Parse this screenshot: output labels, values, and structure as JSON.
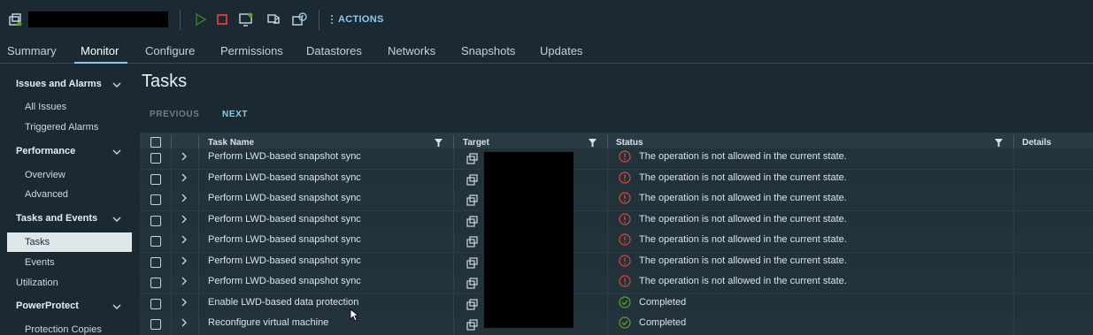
{
  "toolbar": {
    "actions_label": "ACTIONS",
    "icons": [
      "vm-icon",
      "power-on-icon",
      "power-off-icon",
      "console-icon",
      "migrate-icon",
      "snapshot-icon"
    ]
  },
  "tabs": [
    {
      "label": "Summary"
    },
    {
      "label": "Monitor",
      "active": true
    },
    {
      "label": "Configure"
    },
    {
      "label": "Permissions"
    },
    {
      "label": "Datastores"
    },
    {
      "label": "Networks"
    },
    {
      "label": "Snapshots"
    },
    {
      "label": "Updates"
    }
  ],
  "sidebar": {
    "issues_head": "Issues and Alarms",
    "all_issues": "All Issues",
    "triggered_alarms": "Triggered Alarms",
    "performance_head": "Performance",
    "overview": "Overview",
    "advanced": "Advanced",
    "tasks_head": "Tasks and Events",
    "tasks": "Tasks",
    "events": "Events",
    "utilization": "Utilization",
    "powerprotect_head": "PowerProtect",
    "protection_copies": "Protection Copies"
  },
  "main": {
    "title": "Tasks",
    "previous": "PREVIOUS",
    "next": "NEXT"
  },
  "table": {
    "columns": {
      "task_name": "Task Name",
      "target": "Target",
      "status": "Status",
      "details": "Details"
    },
    "rows": [
      {
        "task": "Perform LWD-based snapshot sync",
        "status": "The operation is not allowed in the current state.",
        "state": "error"
      },
      {
        "task": "Perform LWD-based snapshot sync",
        "status": "The operation is not allowed in the current state.",
        "state": "error"
      },
      {
        "task": "Perform LWD-based snapshot sync",
        "status": "The operation is not allowed in the current state.",
        "state": "error"
      },
      {
        "task": "Perform LWD-based snapshot sync",
        "status": "The operation is not allowed in the current state.",
        "state": "error"
      },
      {
        "task": "Perform LWD-based snapshot sync",
        "status": "The operation is not allowed in the current state.",
        "state": "error"
      },
      {
        "task": "Perform LWD-based snapshot sync",
        "status": "The operation is not allowed in the current state.",
        "state": "error"
      },
      {
        "task": "Perform LWD-based snapshot sync",
        "status": "The operation is not allowed in the current state.",
        "state": "error"
      },
      {
        "task": "Enable LWD-based data protection",
        "status": "Completed",
        "state": "ok"
      },
      {
        "task": "Reconfigure virtual machine",
        "status": "Completed",
        "state": "ok"
      }
    ]
  },
  "colors": {
    "background": "#1b2a32",
    "accent": "#8ec8ec",
    "error": "#e0433b",
    "success": "#5aa220"
  }
}
